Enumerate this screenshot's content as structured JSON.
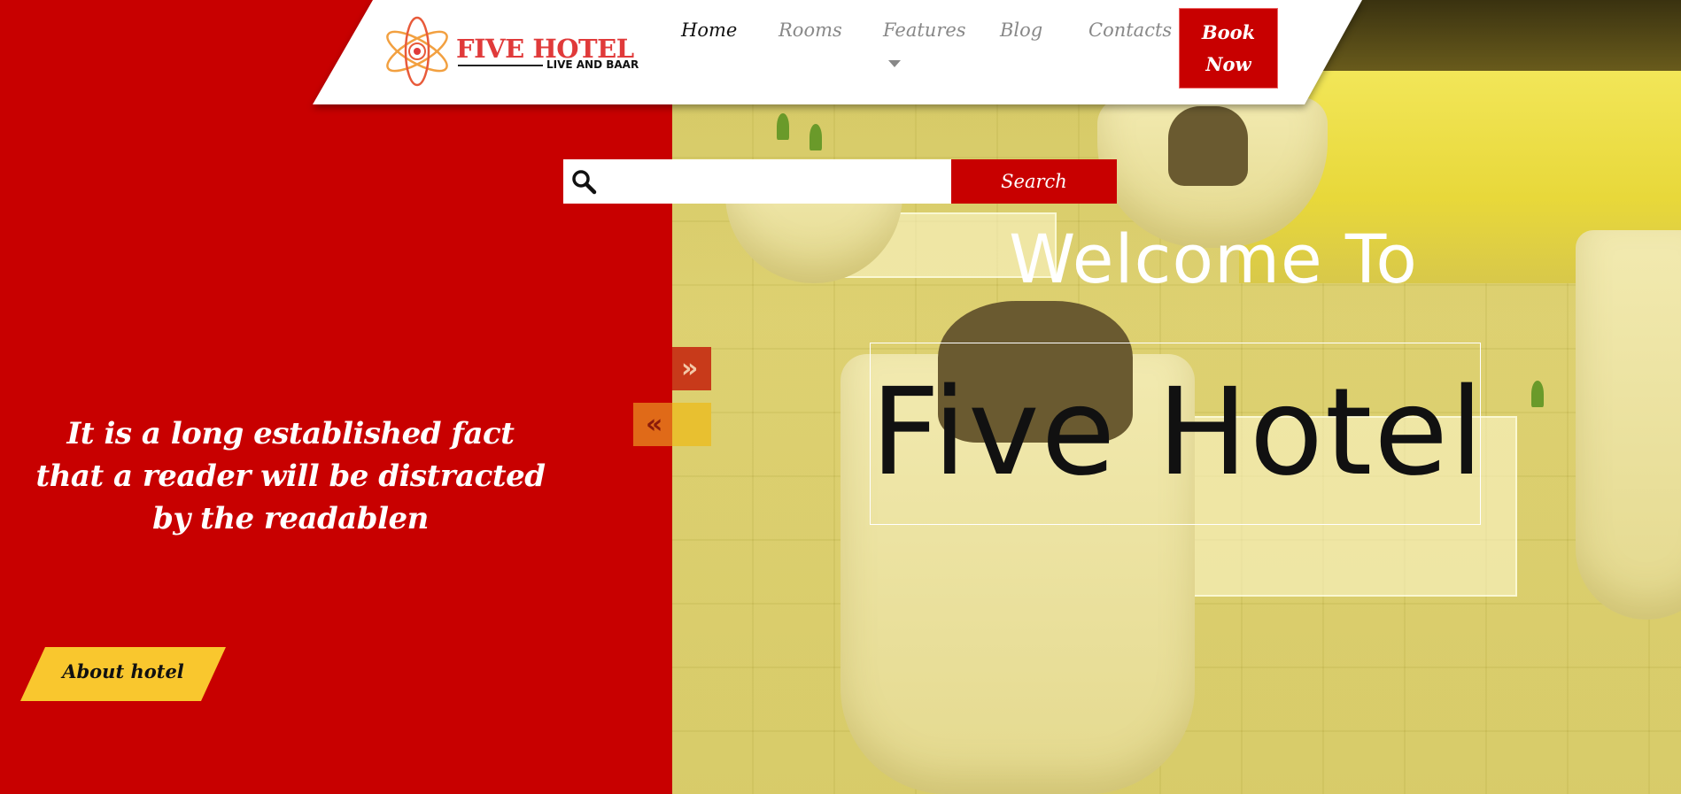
{
  "brand": {
    "name": "FIVE HOTEL",
    "tagline": "LIVE AND BAAR"
  },
  "nav": {
    "items": [
      {
        "label": "Home",
        "active": true
      },
      {
        "label": "Rooms",
        "active": false
      },
      {
        "label": "Features",
        "active": false,
        "has_dropdown": true
      },
      {
        "label": "Blog",
        "active": false
      },
      {
        "label": "Contacts",
        "active": false
      }
    ],
    "book_label": "Book Now"
  },
  "search": {
    "placeholder": "",
    "button_label": "Search",
    "icon": "search-icon"
  },
  "hero": {
    "welcome": "Welcome To",
    "title": "Five Hotel",
    "next_icon": "»",
    "prev_icon": "«"
  },
  "intro": {
    "text": "It is a long established fact that a reader will be distracted by the readablen",
    "button_label": "About hotel"
  },
  "colors": {
    "primary_red": "#c80000",
    "accent_yellow": "#f9c72e",
    "hero_overlay": "#d9cb62"
  }
}
